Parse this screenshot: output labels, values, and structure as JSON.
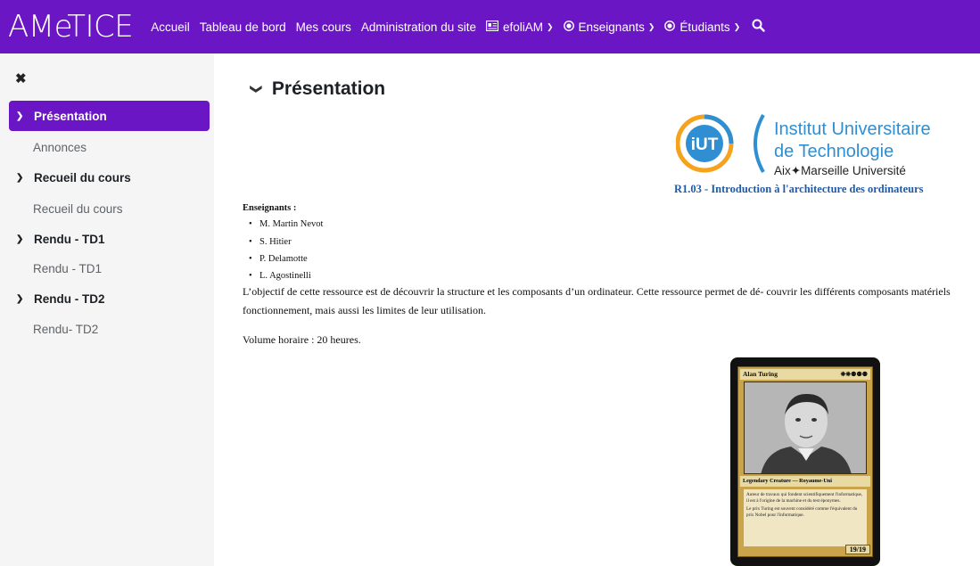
{
  "navbar": {
    "brand": "AMeTICE",
    "items": [
      {
        "label": "Accueil"
      },
      {
        "label": "Tableau de bord"
      },
      {
        "label": "Mes cours"
      },
      {
        "label": "Administration du site"
      },
      {
        "label": "efoliAM",
        "icon": "id-card-icon"
      },
      {
        "label": "Enseignants",
        "icon": "dot-circle-icon"
      },
      {
        "label": "Étudiants",
        "icon": "dot-circle-icon"
      }
    ],
    "search_icon": "search-icon"
  },
  "sidebar": {
    "close_icon": "close-icon",
    "active": "Présentation",
    "items": [
      {
        "label": "Annonces"
      },
      {
        "label": "Recueil du cours",
        "type": "section"
      },
      {
        "label": "Recueil du cours"
      },
      {
        "label": "Rendu - TD1",
        "type": "section"
      },
      {
        "label": "Rendu - TD1"
      },
      {
        "label": "Rendu - TD2",
        "type": "section"
      },
      {
        "label": "Rendu- TD2"
      }
    ]
  },
  "main": {
    "section_title": "Présentation",
    "logo": {
      "line1": "Institut Universitaire",
      "line2": "de Technologie",
      "line3": "Aix✦Marseille Université",
      "badge": "iUT"
    },
    "course_code": "R1.03 - Introduction à l'architecture des ordinateurs",
    "teachers_label": "Enseignants :",
    "teachers": [
      "M. Martin Nevot",
      "S. Hitier",
      "P. Delamotte",
      "L. Agostinelli"
    ],
    "paragraph1": "L’objectif de cette ressource est de découvrir la structure et les composants d’un ordinateur. Cette ressource permet de dé- couvrir les différents composants matériels",
    "paragraph1_line2": "fonctionnement, mais aussi les limites de leur utilisation.",
    "volume": "Volume horaire : 20 heures.",
    "card": {
      "name": "Alan Turing",
      "cost": "❋❋⚉⚉⚉",
      "type": "Legendary Creature — Royaume-Uni",
      "text1": "Auteur de travaux qui fondent scientifiquement l'informatique, il est à l'origine de la machine et du test éponymes.",
      "text2": "Le prix Turing est souvent considéré comme l'équivalent du prix Nobel pour l'informatique.",
      "pt": "19/19"
    }
  }
}
